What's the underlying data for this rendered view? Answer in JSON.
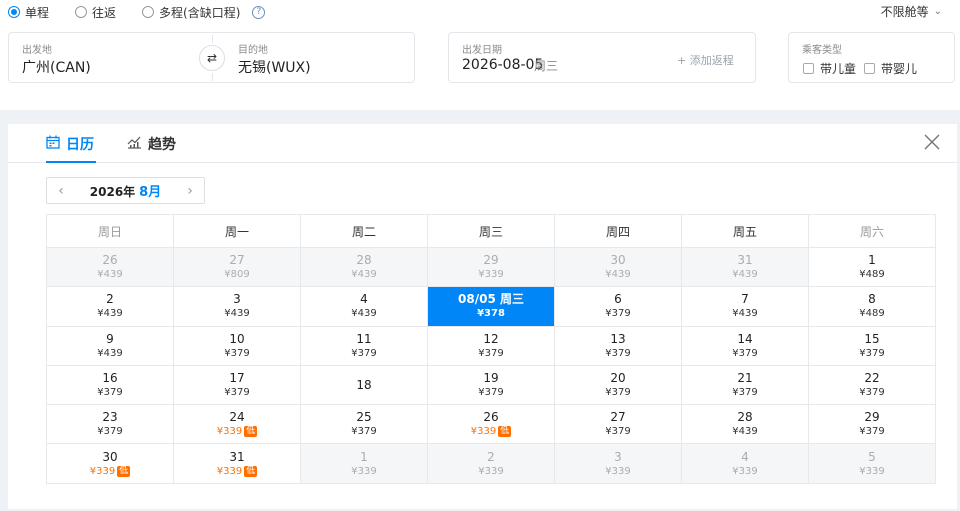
{
  "trip_types": [
    {
      "label": "单程",
      "selected": true
    },
    {
      "label": "往返",
      "selected": false
    },
    {
      "label": "多程(含缺口程)",
      "selected": false
    }
  ],
  "help_icon": "?",
  "cabin": {
    "label": "不限舱等"
  },
  "from": {
    "label": "出发地",
    "value": "广州(CAN)"
  },
  "to": {
    "label": "目的地",
    "value": "无锡(WUX)"
  },
  "depart": {
    "label": "出发日期",
    "value": "2026-08-05",
    "weekday": "周三"
  },
  "add_return": "+ 添加返程",
  "passenger": {
    "label": "乘客类型",
    "options": [
      "带儿童",
      "带婴儿"
    ]
  },
  "tabs": [
    {
      "label": "日历",
      "icon": "calendar-icon",
      "active": true
    },
    {
      "label": "趋势",
      "icon": "trend-chart-icon",
      "active": false
    }
  ],
  "month_nav": {
    "year": "2026年",
    "month": "8月",
    "prev": "‹",
    "next": "›"
  },
  "weekdays": [
    "周日",
    "周一",
    "周二",
    "周三",
    "周四",
    "周五",
    "周六"
  ],
  "low_badge": "低",
  "colors": {
    "accent": "#0086f6",
    "low_price": "#ff6f00"
  },
  "weeks": [
    [
      {
        "day": "26",
        "price": "¥439",
        "other": true
      },
      {
        "day": "27",
        "price": "¥809",
        "other": true
      },
      {
        "day": "28",
        "price": "¥439",
        "other": true
      },
      {
        "day": "29",
        "price": "¥339",
        "other": true
      },
      {
        "day": "30",
        "price": "¥439",
        "other": true
      },
      {
        "day": "31",
        "price": "¥439",
        "other": true
      },
      {
        "day": "1",
        "price": "¥489"
      }
    ],
    [
      {
        "day": "2",
        "price": "¥439"
      },
      {
        "day": "3",
        "price": "¥439"
      },
      {
        "day": "4",
        "price": "¥439"
      },
      {
        "day": "08/05 周三",
        "price": "¥378",
        "selected": true
      },
      {
        "day": "6",
        "price": "¥379"
      },
      {
        "day": "7",
        "price": "¥439"
      },
      {
        "day": "8",
        "price": "¥489"
      }
    ],
    [
      {
        "day": "9",
        "price": "¥439"
      },
      {
        "day": "10",
        "price": "¥379"
      },
      {
        "day": "11",
        "price": "¥379"
      },
      {
        "day": "12",
        "price": "¥379"
      },
      {
        "day": "13",
        "price": "¥379"
      },
      {
        "day": "14",
        "price": "¥379"
      },
      {
        "day": "15",
        "price": "¥379"
      }
    ],
    [
      {
        "day": "16",
        "price": "¥379"
      },
      {
        "day": "17",
        "price": "¥379"
      },
      {
        "day": "18",
        "price": ""
      },
      {
        "day": "19",
        "price": "¥379"
      },
      {
        "day": "20",
        "price": "¥379"
      },
      {
        "day": "21",
        "price": "¥379"
      },
      {
        "day": "22",
        "price": "¥379"
      }
    ],
    [
      {
        "day": "23",
        "price": "¥379"
      },
      {
        "day": "24",
        "price": "¥339",
        "low": true
      },
      {
        "day": "25",
        "price": "¥379"
      },
      {
        "day": "26",
        "price": "¥339",
        "low": true
      },
      {
        "day": "27",
        "price": "¥379"
      },
      {
        "day": "28",
        "price": "¥439"
      },
      {
        "day": "29",
        "price": "¥379"
      }
    ],
    [
      {
        "day": "30",
        "price": "¥339",
        "low": true
      },
      {
        "day": "31",
        "price": "¥339",
        "low": true
      },
      {
        "day": "1",
        "price": "¥339",
        "other": true
      },
      {
        "day": "2",
        "price": "¥339",
        "other": true
      },
      {
        "day": "3",
        "price": "¥339",
        "other": true
      },
      {
        "day": "4",
        "price": "¥339",
        "other": true
      },
      {
        "day": "5",
        "price": "¥339",
        "other": true
      }
    ]
  ]
}
